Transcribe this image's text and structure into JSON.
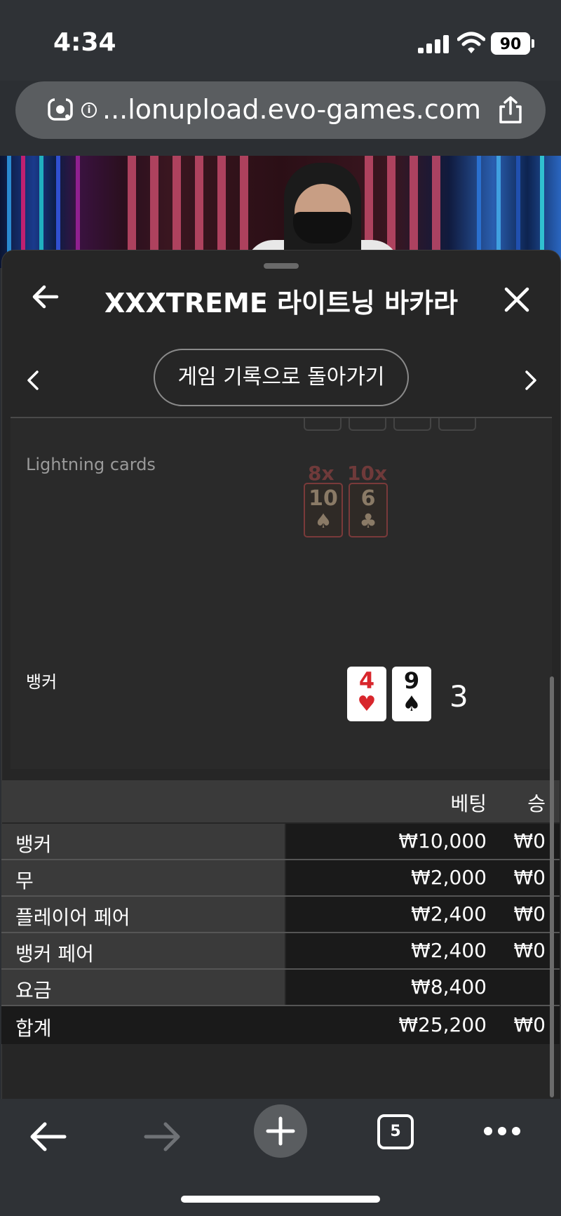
{
  "status_bar": {
    "time": "4:34",
    "battery": "90"
  },
  "browser": {
    "url": "...lonupload.evo-games.com",
    "tab_count": "5"
  },
  "sheet": {
    "title": "XXXTREME 라이트닝 바카라",
    "history_button": "게임 기록으로 돌아가기"
  },
  "game": {
    "lightning_label": "Lightning cards",
    "lightning_cards": [
      {
        "multiplier": "8x",
        "rank": "10",
        "suit": "♠"
      },
      {
        "multiplier": "10x",
        "rank": "6",
        "suit": "♣"
      }
    ],
    "banker_label": "뱅커",
    "banker_cards": [
      {
        "rank": "4",
        "suit": "♥",
        "color": "#d8262c"
      },
      {
        "rank": "9",
        "suit": "♠",
        "color": "#111111"
      }
    ],
    "banker_score": "3"
  },
  "bets": {
    "header_bet": "베팅",
    "header_win": "승",
    "rows": [
      {
        "label": "뱅커",
        "bet": "₩10,000",
        "win": "₩0"
      },
      {
        "label": "무",
        "bet": "₩2,000",
        "win": "₩0"
      },
      {
        "label": "플레이어 페어",
        "bet": "₩2,400",
        "win": "₩0"
      },
      {
        "label": "뱅커 페어",
        "bet": "₩2,400",
        "win": "₩0"
      },
      {
        "label": "요금",
        "bet": "₩8,400",
        "win": ""
      }
    ],
    "total": {
      "label": "합계",
      "bet": "₩25,200",
      "win": "₩0"
    }
  }
}
